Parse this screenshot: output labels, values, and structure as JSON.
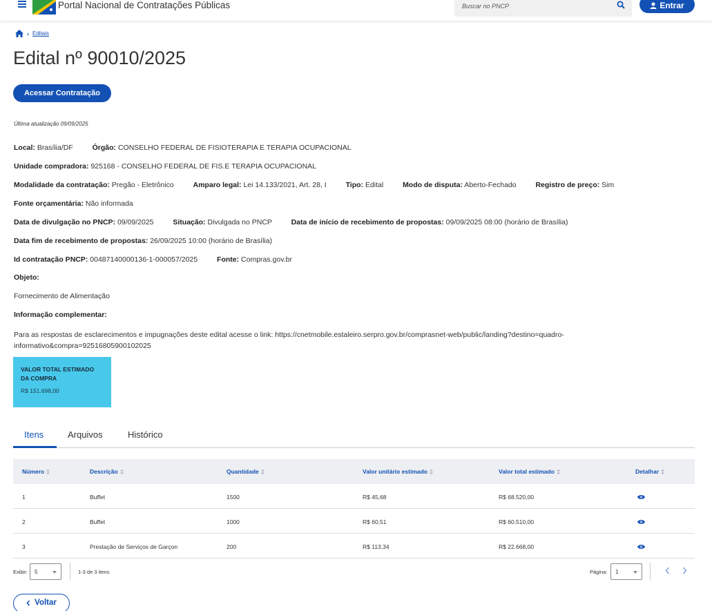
{
  "header": {
    "portal_title": "Portal Nacional de Contratações Públicas",
    "search_placeholder": "Buscar no PNCP",
    "login_label": "Entrar",
    "brand_color": "#1351b4"
  },
  "breadcrumb": {
    "items": [
      "Editais"
    ]
  },
  "page": {
    "title": "Edital nº 90010/2025",
    "access_button": "Acessar Contratação",
    "last_update": "Última atualização 09/09/2025"
  },
  "info": {
    "local": {
      "label": "Local:",
      "value": "Brasília/DF"
    },
    "orgao": {
      "label": "Órgão:",
      "value": "CONSELHO FEDERAL DE FISIOTERAPIA E TERAPIA OCUPACIONAL"
    },
    "unidade": {
      "label": "Unidade compradora:",
      "value": "925168 - CONSELHO FEDERAL DE FIS.E TERAPIA OCUPACIONAL"
    },
    "modalidade": {
      "label": "Modalidade da contratação:",
      "value": "Pregão - Eletrônico"
    },
    "amparo": {
      "label": "Amparo legal:",
      "value": "Lei 14.133/2021, Art. 28, I"
    },
    "tipo": {
      "label": "Tipo:",
      "value": "Edital"
    },
    "modo": {
      "label": "Modo de disputa:",
      "value": "Aberto-Fechado"
    },
    "registro": {
      "label": "Registro de preço:",
      "value": "Sim"
    },
    "fonte_orc": {
      "label": "Fonte orçamentária:",
      "value": "Não informada"
    },
    "divulgacao": {
      "label": "Data de divulgação no PNCP:",
      "value": "09/09/2025"
    },
    "situacao": {
      "label": "Situação:",
      "value": "Divulgada no PNCP"
    },
    "inicio": {
      "label": "Data de início de recebimento de propostas:",
      "value": "09/09/2025 08:00 (horário de Brasília)"
    },
    "fim": {
      "label": "Data fim de recebimento de propostas:",
      "value": "26/09/2025 10:00 (horário de Brasília)"
    },
    "id": {
      "label": "Id contratação PNCP:",
      "value": "00487140000136-1-000057/2025"
    },
    "fonte": {
      "label": "Fonte:",
      "value": "Compras.gov.br"
    },
    "objeto_label": "Objeto:",
    "objeto_value": "Fornecimento de Alimentação",
    "complemento_label": "Informação complementar:",
    "complemento_value": "Para as respostas de esclarecimentos e impugnações deste edital acesse o link: https://cnetmobile.estaleiro.serpro.gov.br/comprasnet-web/public/landing?destino=quadro-informativo&compra=92516805900102025"
  },
  "value_card": {
    "label": "VALOR TOTAL ESTIMADO DA COMPRA",
    "amount": "R$ 151.698,00",
    "color": "#48c9eb"
  },
  "tabs": [
    {
      "label": "Itens",
      "active": true
    },
    {
      "label": "Arquivos",
      "active": false
    },
    {
      "label": "Histórico",
      "active": false
    }
  ],
  "table": {
    "headers": [
      "Número",
      "Descrição",
      "Quantidade",
      "Valor unitário estimado",
      "Valor total estimado",
      "Detalhar"
    ],
    "rows": [
      [
        "1",
        "Buffet",
        "1500",
        "R$ 45,68",
        "R$ 68.520,00"
      ],
      [
        "2",
        "Buffet",
        "1000",
        "R$ 60,51",
        "R$ 60.510,00"
      ],
      [
        "3",
        "Prestação de Serviços de Garçon",
        "200",
        "R$ 113,34",
        "R$ 22.668,00"
      ]
    ]
  },
  "pager": {
    "show_label": "Exibir:",
    "show_value": "5",
    "range_text": "1-3 de 3 itens",
    "page_label": "Página:",
    "page_value": "1"
  },
  "back_label": "Voltar"
}
